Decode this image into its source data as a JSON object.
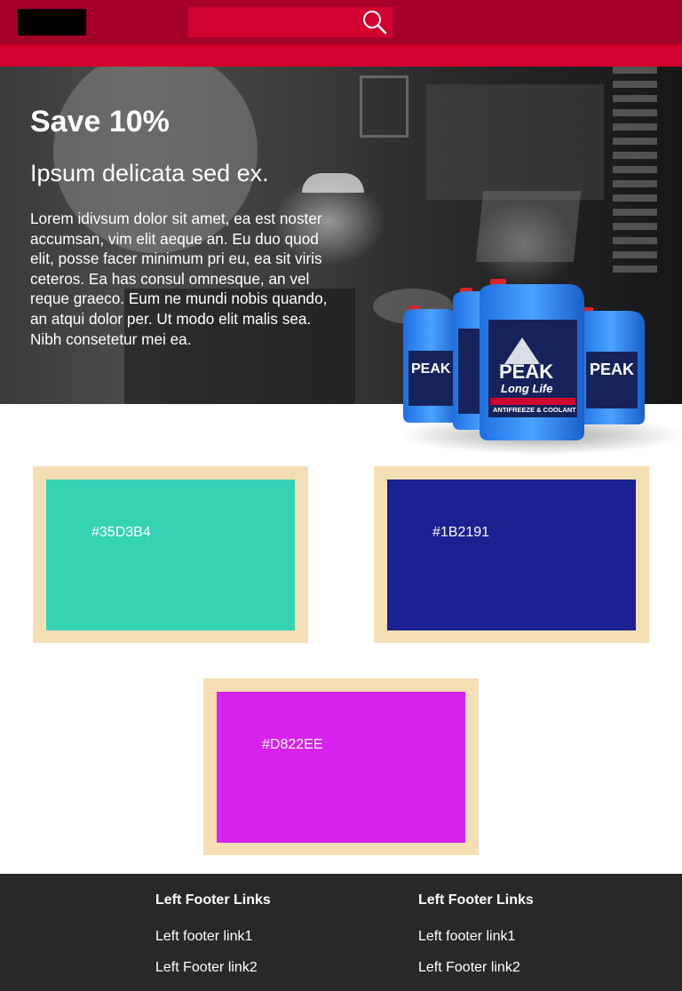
{
  "header": {
    "search": {
      "placeholder": "",
      "value": "",
      "icon": "search-icon"
    },
    "colors": {
      "topbar": "#a5002a",
      "navbar": "#d0002f",
      "search_bg": "#d0002f"
    }
  },
  "hero": {
    "title": "Save 10%",
    "subtitle": "Ipsum delicata sed ex.",
    "body": "Lorem idivsum dolor sit amet, ea est noster accumsan, vim elit aeque an. Eu duo quod elit, posse facer minimum pri eu, ea sit viris ceteros. Ea has consul omnesque, an vel reque graeco. Eum ne mundi nobis quando, an atqui dolor per. Ut modo elit malis sea. Nibh consetetur mei ea.",
    "product": {
      "brand": "PEAK",
      "line": "Long Life",
      "label": "ANTIFREEZE & COOLANT"
    }
  },
  "colors": {
    "card_border": "#f4dfb4",
    "swatches": [
      {
        "label": "#35D3B4",
        "color": "#35D3B4"
      },
      {
        "label": "#1B2191",
        "color": "#1B2191"
      },
      {
        "label": "#D822EE",
        "color": "#D822EE"
      }
    ]
  },
  "footer": {
    "background": "#282828",
    "columns": [
      {
        "heading": "Left Footer Links",
        "links": [
          "Left footer link1",
          "Left Footer link2"
        ]
      },
      {
        "heading": "Left Footer Links",
        "links": [
          "Left footer link1",
          "Left Footer link2"
        ]
      }
    ]
  }
}
